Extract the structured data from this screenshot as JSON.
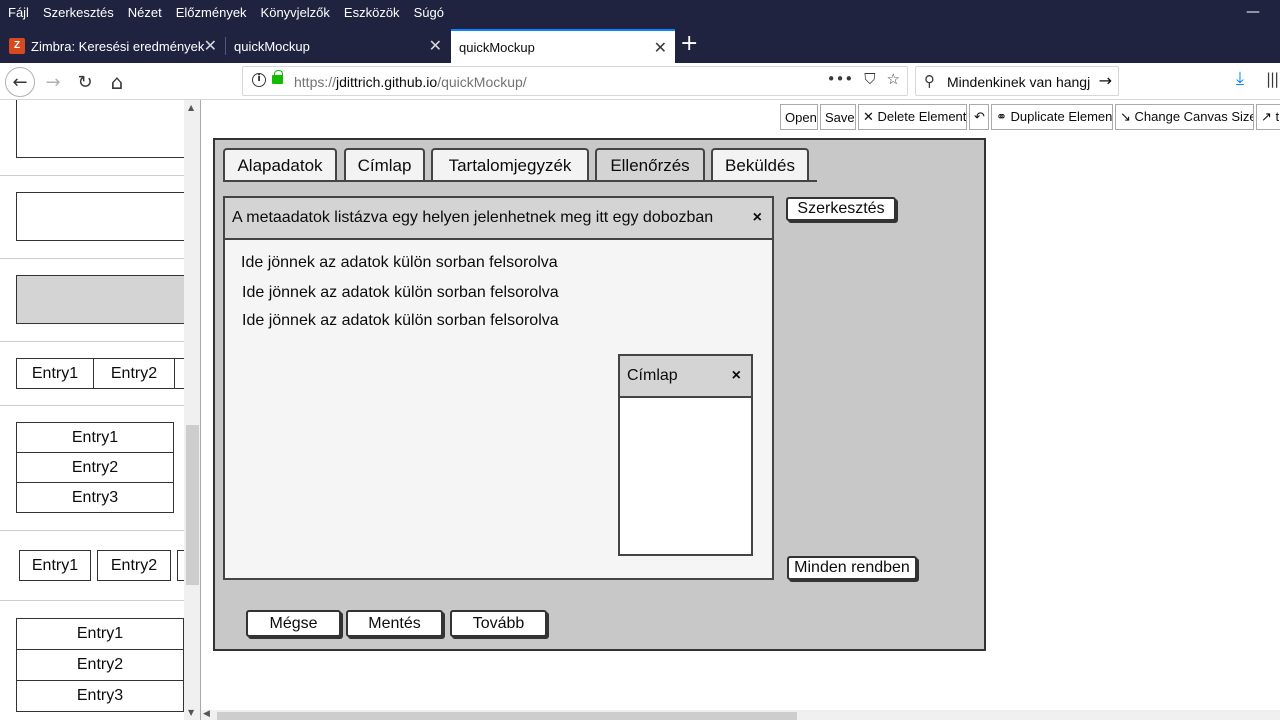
{
  "menubar": {
    "items": [
      "Fájl",
      "Szerkesztés",
      "Nézet",
      "Előzmények",
      "Könyvjelzők",
      "Eszközök",
      "Súgó"
    ],
    "minimize": "—"
  },
  "tabs": [
    {
      "label": "Zimbra: Keresési eredmények",
      "close": "✕",
      "favicon": "Z"
    },
    {
      "label": "quickMockup",
      "close": "✕"
    },
    {
      "label": "quickMockup",
      "close": "✕"
    }
  ],
  "newtab": "+",
  "navbar": {
    "back": "←",
    "forward": "→",
    "reload": "↻",
    "home": "⌂",
    "info": "i",
    "url_prefix": "https://",
    "url_host": "jdittrich.github.io",
    "url_path": "/quickMockup/",
    "page_actions": [
      "•••",
      "⛉",
      "☆"
    ],
    "search_icon": "⚲",
    "search_value": "Mindenkinek van hangj",
    "search_go": "→",
    "download": "⤓",
    "library": "|||"
  },
  "palette": {
    "table1": [
      "Entry1",
      "Entry2"
    ],
    "list1": [
      "Entry1",
      "Entry2",
      "Entry3"
    ],
    "table2": [
      "Entry1",
      "Entry2"
    ],
    "list2": [
      "Entry1",
      "Entry2",
      "Entry3"
    ],
    "arrow_up": "▲",
    "arrow_down": "▼"
  },
  "toolbar": {
    "open": "Open",
    "save": "Save",
    "delete": "✕ Delete Element",
    "undo": "↶",
    "duplicate": "⚭ Duplicate Element",
    "canvas_size": "↘ Change Canvas Size",
    "more": "↗ t"
  },
  "mockup": {
    "tabs": [
      "Alapadatok",
      "Címlap",
      "Tartalomjegyzék",
      "Ellenőrzés",
      "Beküldés"
    ],
    "selected_tab": "Ellenőrzés",
    "main_window": {
      "title": "A metaadatok listázva egy helyen jelenhetnek meg itt egy dobozban",
      "close": "×",
      "lines": [
        "Ide jönnek az adatok külön sorban felsorolva",
        "Ide jönnek az adatok külön sorban felsorolva",
        "Ide jönnek az adatok külön sorban felsorolva"
      ]
    },
    "sub_window": {
      "title": "Címlap",
      "close": "×"
    },
    "edit_button": "Szerkesztés",
    "ok_button": "Minden rendben",
    "cancel_button": "Mégse",
    "save_button": "Mentés",
    "next_button": "Tovább"
  },
  "hscroll": {
    "arrow_left": "◀"
  }
}
